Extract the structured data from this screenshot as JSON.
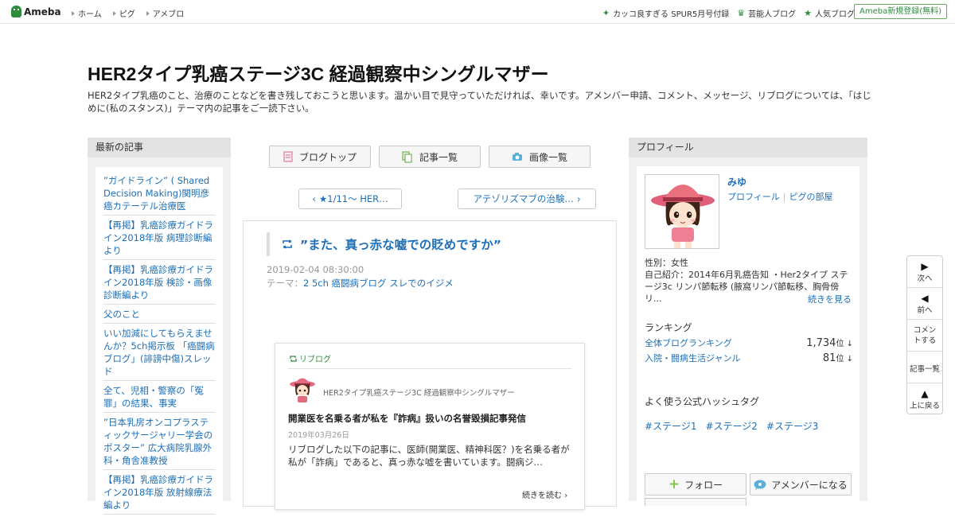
{
  "topbar": {
    "logo": "Ameba",
    "nav": [
      "ホーム",
      "ピグ",
      "アメブロ"
    ],
    "promo": "カッコ良すぎる SPUR5月号付録",
    "celeb": "芸能人ブログ",
    "popular": "人気ブログ",
    "register": "Ameba新規登録(無料)"
  },
  "blog": {
    "title": "HER2タイプ乳癌ステージ3C 経過観察中シングルマザー",
    "description": "HER2タイプ乳癌のこと、治療のことなどを書き残しておこうと思います。温かい目で見守っていただければ、幸いです。アメンバー申請、コメント、メッセージ、リブログについては、「はじめに(私のスタンス)」テーマ内の記事をご一読下さい。"
  },
  "left": {
    "heading": "最新の記事",
    "items": [
      "”ガイドライン” ( Shared Decision Making)関明彦 癌カテーテル治療医",
      "【再掲】乳癌診療ガイドライン2018年版 病理診断編より",
      "【再掲】乳癌診療ガイドライン2018年版 検診・画像診断編より",
      "父のこと",
      "いい加減にしてもらえませんか？5ch掲示板 「癌闘病ブログ」(誹謗中傷)スレッド",
      "全て、児相・警察の「冤罪」の結果、事実",
      "”日本乳房オンコプラスティックサージャリー学会のポスター” 広大病院乳腺外科・角舎准教授",
      "【再掲】乳癌診療ガイドライン2018年版 放射線療法編より"
    ]
  },
  "center": {
    "buttons": [
      "ブログトップ",
      "記事一覧",
      "画像一覧"
    ],
    "prev": "★1/11～ HER…",
    "next": "アテゾリズマブの治験…",
    "article": {
      "title": "”また、真っ赤な嘘での貶めですか”",
      "date": "2019-02-04 08:30:00",
      "theme_label": "テーマ：",
      "theme": "2 5ch 癌闘病ブログ スレでのイジメ"
    },
    "reblog": {
      "label": "リブログ",
      "blog_name": "HER2タイプ乳癌ステージ3C 経過観察中シングルマザー",
      "title": "開業医を名乗る者が私を『詐病』扱いの名誉毀損記事発信",
      "date": "2019年03月26日",
      "excerpt": "リブログした以下の記事に、医師(開業医、精神科医？)を名乗る者が私が「詐病」であると、真っ赤な嘘を書いています。闘病ジ…",
      "more": "続きを読む"
    }
  },
  "right": {
    "heading": "プロフィール",
    "name": "みゆ",
    "profile_link": "プロフィール",
    "pigg_link": "ピグの部屋",
    "gender": "性別：女性",
    "intro": "自己紹介：2014年6月乳癌告知 ・Her2タイプ ステージ3c リンパ節転移 (腋窩リンパ節転移、胸骨傍リ...",
    "more": "続きを見る",
    "ranking_heading": "ランキング",
    "rankings": [
      {
        "label": "全体ブログランキング",
        "value": "1,734",
        "unit": "位 ↓"
      },
      {
        "label": "入院・闘病生活ジャンル",
        "value": "81",
        "unit": "位 ↓"
      }
    ],
    "hashtag_heading": "よく使う公式ハッシュタグ",
    "hashtags": [
      "#ステージ1",
      "#ステージ2",
      "#ステージ3"
    ],
    "follow": "フォロー",
    "amember": "アメンバーになる"
  },
  "floatnav": {
    "next": "次へ",
    "prev": "前へ",
    "comment": "コメントする",
    "list": "記事一覧",
    "top": "上に戻る"
  },
  "colors": {
    "brand": "#2d8c3c",
    "link": "#1c6fb8",
    "accent": "#7ec850"
  }
}
